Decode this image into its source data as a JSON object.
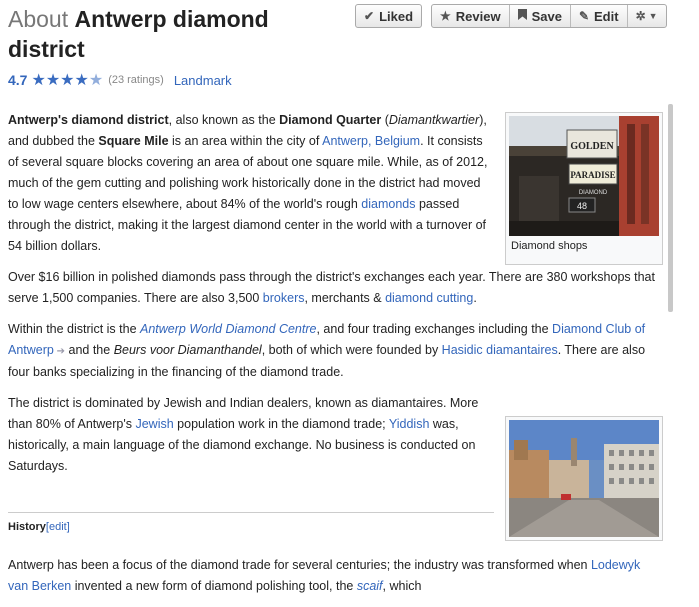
{
  "header": {
    "about": "About",
    "name": "Antwerp diamond district"
  },
  "rating": {
    "score": "4.7",
    "count": "(23 ratings)",
    "category": "Landmark"
  },
  "buttons": {
    "liked": "Liked",
    "review": "Review",
    "save": "Save",
    "edit": "Edit"
  },
  "p1": {
    "t1": "Antwerp's diamond district",
    "t2": ", also known as the ",
    "t3": "Diamond Quarter",
    "t4": " (",
    "t5": "Diamantkwartier",
    "t6": "), and dubbed the ",
    "t7": "Square Mile",
    "t8": " is an area within the city of ",
    "l1": "Antwerp, Belgium",
    "t9": ". It consists of several square blocks covering an area of about one square mile. While, as of 2012, much of the gem cutting and polishing work historically done in the district had moved to low wage centers elsewhere, about 84% of the world's rough ",
    "l2": "diamonds",
    "t10": " passed through the district, making it the largest diamond center in the world with a turnover of 54 billion dollars."
  },
  "p2": {
    "t1": "Over $16 billion in polished diamonds pass through the district's exchanges each year. There are 380 workshops that serve 1,500 companies. There are also 3,500 ",
    "l1": "brokers",
    "t2": ", merchants & ",
    "l2": "diamond cutting",
    "t3": "."
  },
  "p3": {
    "t1": "Within the district is the ",
    "l1": "Antwerp World Diamond Centre",
    "t2": ", and four trading exchanges including the ",
    "l2": "Diamond Club of Antwerp",
    "t3": " and the ",
    "t4": "Beurs voor Diamanthandel",
    "t5": ", both of which were founded by ",
    "l3": "Hasidic diamantaires",
    "t6": ". There are also four banks specializing in the financing of the diamond trade."
  },
  "p4": {
    "t1": "The district is dominated by Jewish and Indian dealers, known as diamantaires. More than 80% of Antwerp's ",
    "l1": "Jewish",
    "t2": " population work in the diamond trade; ",
    "l2": "Yiddish",
    "t3": " was, historically, a main language of the diamond exchange. No business is conducted on Saturdays."
  },
  "section": {
    "title": "History",
    "edit": "[edit]"
  },
  "p5": {
    "t1": "Antwerp has been a focus of the diamond trade for several centuries; the industry was transformed when ",
    "l1": "Lodewyk van Berken",
    "t2": " invented a new form of diamond polishing tool, the ",
    "l2": "scaif",
    "t3": ", which"
  },
  "images": {
    "shops_caption": "Diamond shops",
    "sign1": "GOLDEN",
    "sign2": "PARADISE",
    "sign3": "DIAMOND",
    "sign4": "48"
  }
}
